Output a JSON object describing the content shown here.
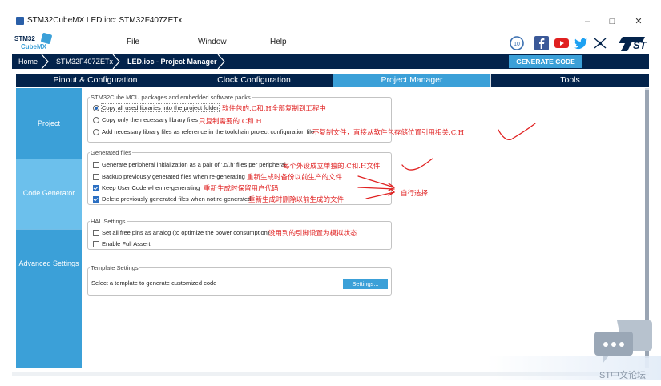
{
  "window": {
    "title": "STM32CubeMX LED.ioc: STM32F407ZETx",
    "minimize": "–",
    "maximize": "□",
    "close": "✕"
  },
  "logo": {
    "line1": "STM32",
    "line2": "CubeMX"
  },
  "menu": {
    "file": "File",
    "window": "Window",
    "help": "Help"
  },
  "social_icons": [
    "anniversary-icon",
    "facebook-icon",
    "youtube-icon",
    "twitter-icon",
    "network-icon",
    "st-logo-icon"
  ],
  "breadcrumb": {
    "home": "Home",
    "mcu": "STM32F407ZETx",
    "project": "LED.ioc - Project Manager"
  },
  "generate_button": "GENERATE CODE",
  "tabs": [
    "Pinout & Configuration",
    "Clock Configuration",
    "Project Manager",
    "Tools"
  ],
  "active_tab": "Project Manager",
  "sidebar": {
    "items": [
      "Project",
      "Code Generator",
      "Advanced Settings"
    ],
    "active": "Code Generator"
  },
  "mcu_packages": {
    "legend": "STM32Cube MCU packages and embedded software packs",
    "options": [
      {
        "label": "Copy all used libraries into the project folder",
        "selected": true
      },
      {
        "label": "Copy only the necessary library files",
        "selected": false
      },
      {
        "label": "Add necessary library files as reference in the toolchain project configuration file",
        "selected": false
      }
    ],
    "annotations": [
      "软件包的.C和.H全部复制到工程中",
      "只复制需要的.C和.H",
      "不复制文件，直接从软件包存储位置引用相关.C.H"
    ]
  },
  "generated_files": {
    "legend": "Generated files",
    "options": [
      {
        "label": "Generate peripheral initialization as a pair of '.c/.h' files per peripheral",
        "checked": false
      },
      {
        "label": "Backup previously generated files when re-generating",
        "checked": false
      },
      {
        "label": "Keep User Code when re-generating",
        "checked": true
      },
      {
        "label": "Delete previously generated files when not re-generated",
        "checked": true
      }
    ],
    "annotations": [
      "每个外设成立单独的.C和.H文件",
      "重新生成时备份以前生产的文件",
      "重新生成时保留用户代码",
      "重新生成时删除以前生成的文件"
    ],
    "choose_note": "自行选择"
  },
  "hal_settings": {
    "legend": "HAL Settings",
    "options": [
      {
        "label": "Set all free pins as analog (to optimize the power consumption)",
        "checked": false
      },
      {
        "label": "Enable Full Assert",
        "checked": false
      }
    ],
    "annotation": "没用到的引脚设置为模拟状态"
  },
  "template_settings": {
    "legend": "Template Settings",
    "text": "Select a template to generate customized code",
    "button": "Settings..."
  },
  "watermark": "ST中文论坛",
  "colors": {
    "navy": "#03234b",
    "accent": "#3ba0d8",
    "annotation": "#e02222"
  }
}
